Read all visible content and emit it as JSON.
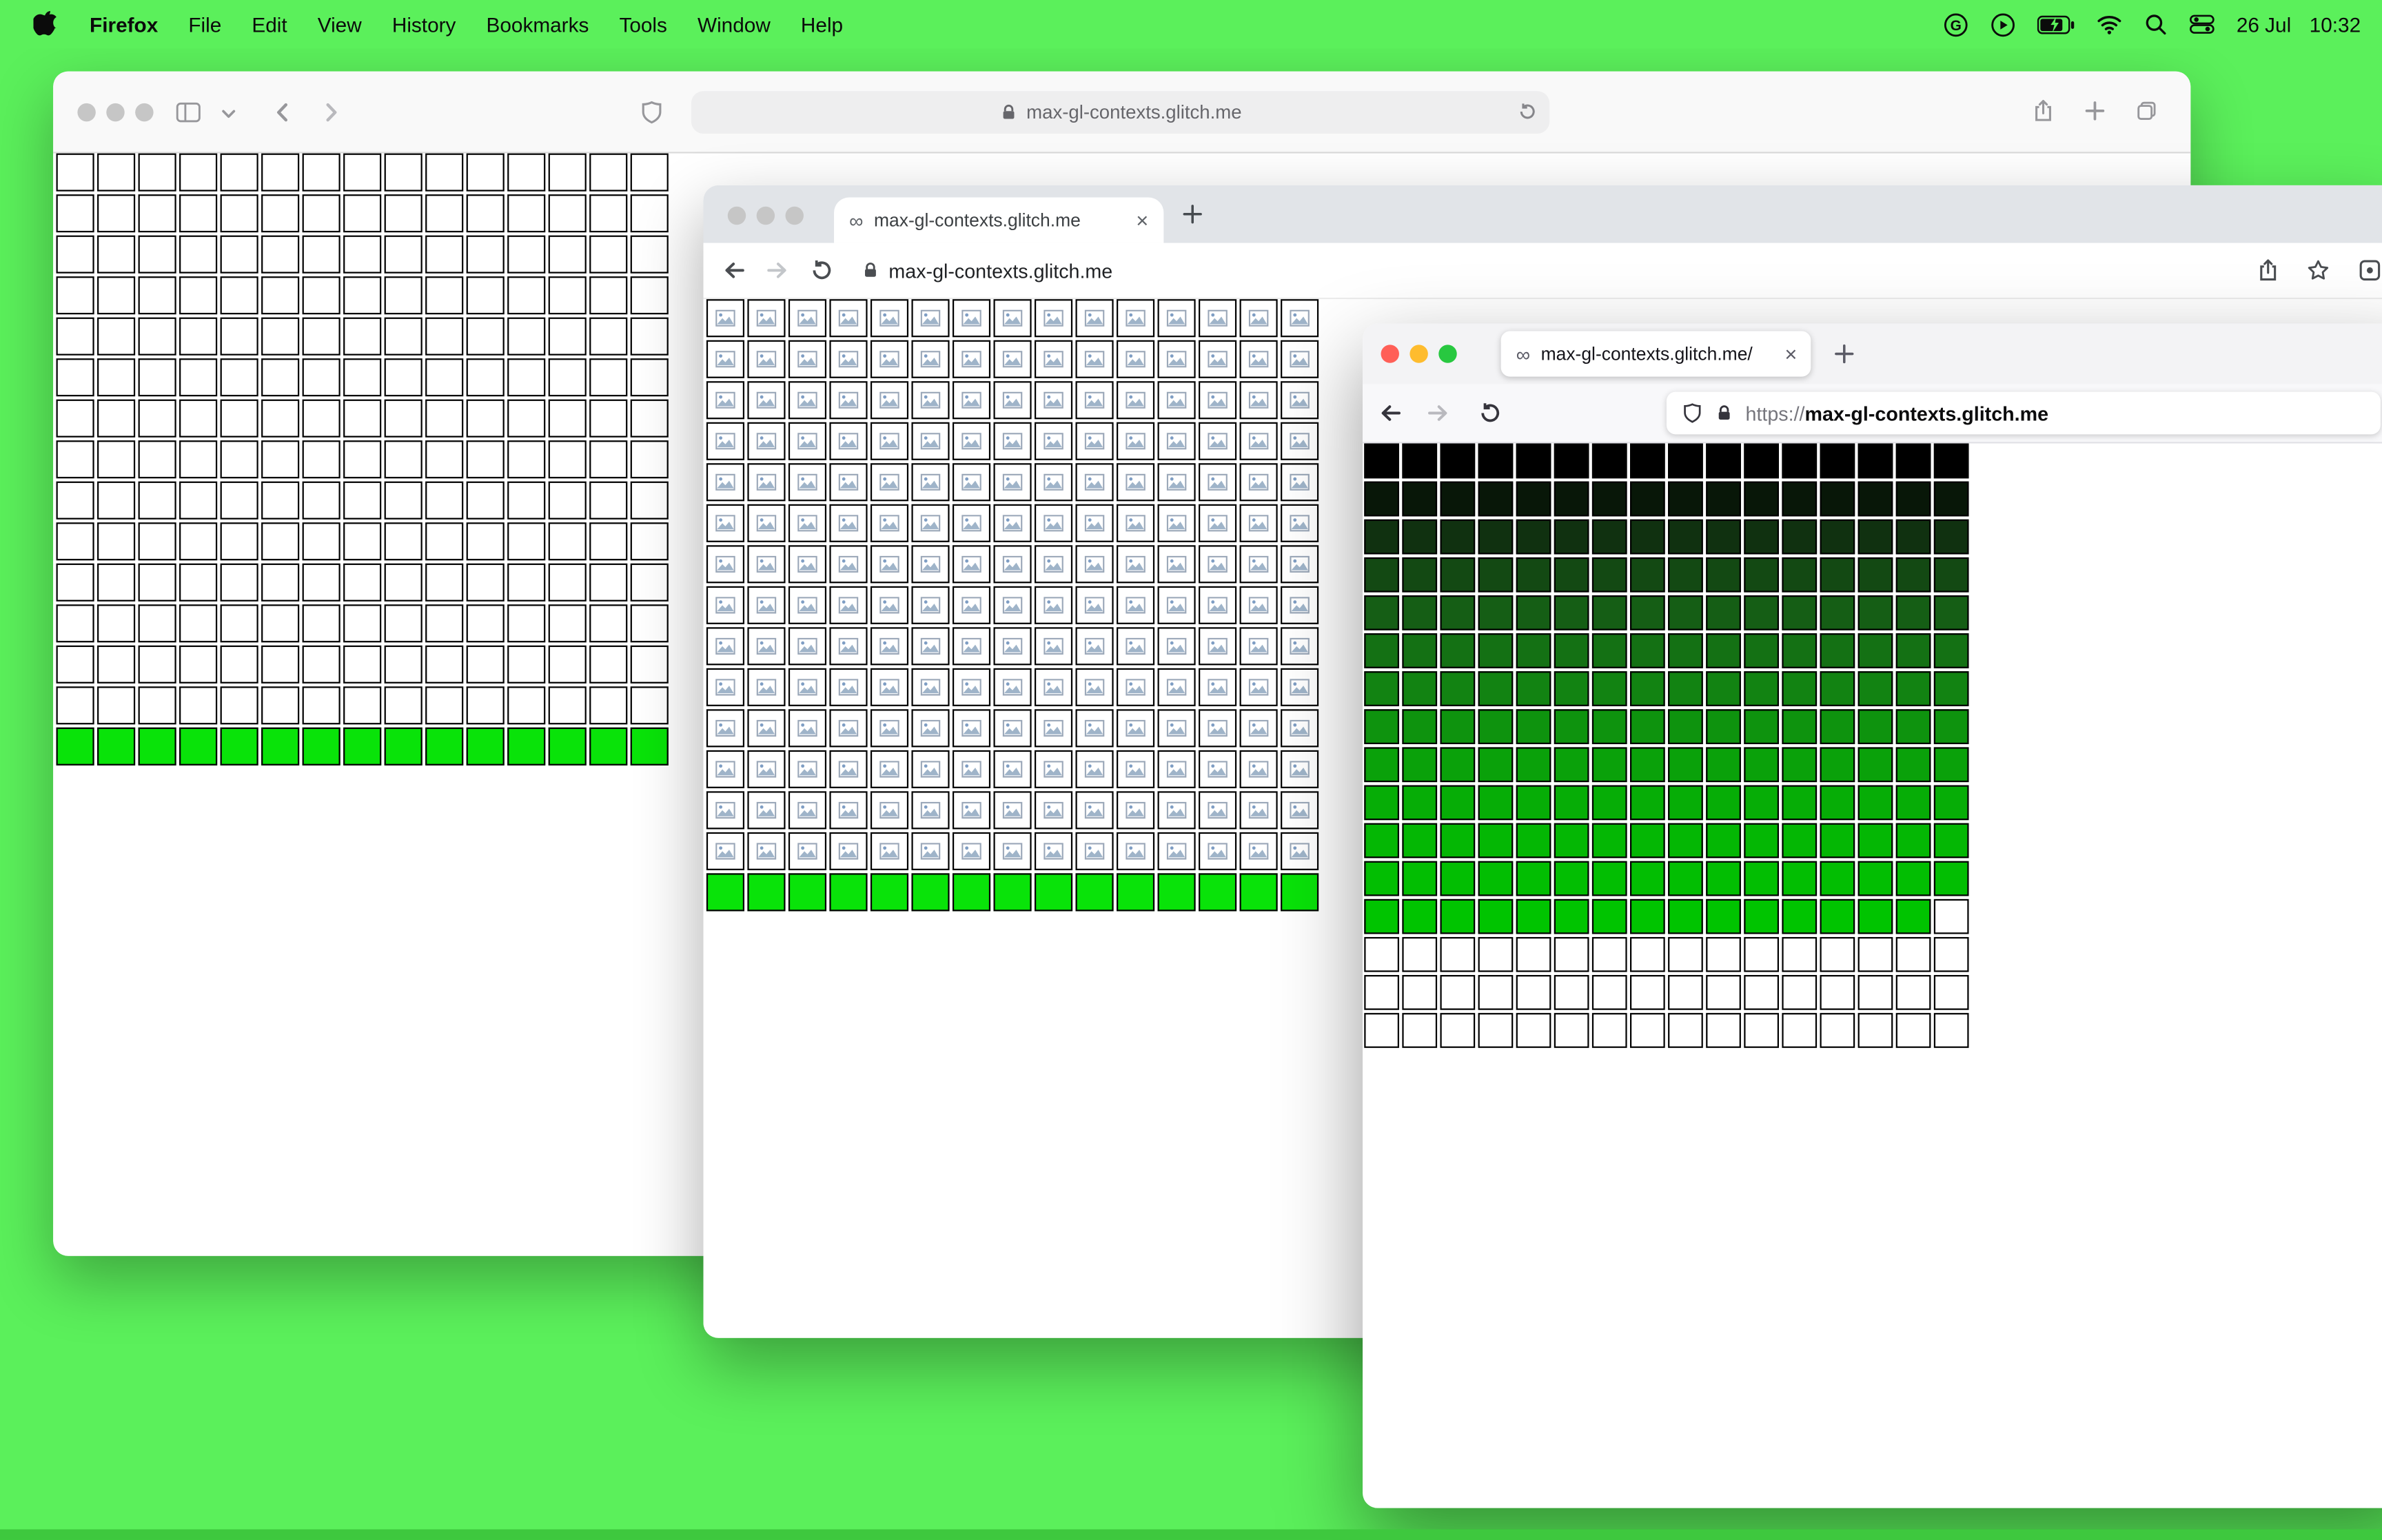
{
  "colors": {
    "desktop_green": "#5bf05b",
    "dock_strip_green": "#3ec83e",
    "bright_cell_green": "#09e309",
    "cell_border": "#000000",
    "traffic_red": "#ff5f57",
    "traffic_yellow": "#febc2e",
    "traffic_green": "#28c840"
  },
  "icons": {
    "infinity": "∞",
    "close": "×"
  },
  "menubar": {
    "app_name": "Firefox",
    "menus": [
      "File",
      "Edit",
      "View",
      "History",
      "Bookmarks",
      "Tools",
      "Window",
      "Help"
    ],
    "date": "26 Jul",
    "time": "10:32"
  },
  "safari": {
    "url": "max-gl-contexts.glitch.me"
  },
  "chrome": {
    "tab_title": "max-gl-contexts.glitch.me",
    "url": "max-gl-contexts.glitch.me"
  },
  "firefox": {
    "tab_title": "max-gl-contexts.glitch.me/",
    "url_scheme": "https://",
    "url_domain": "max-gl-contexts.glitch.me"
  },
  "grids": {
    "safari": {
      "cols": 15,
      "pitch": 27,
      "cell": 25,
      "rows": [
        {
          "count": 14,
          "color": "#ffffff"
        },
        {
          "count": 1,
          "color": "#09e309"
        }
      ]
    },
    "chrome": {
      "cols": 15,
      "pitch": 27,
      "cell": 25,
      "rows": [
        {
          "count": 14,
          "color": "#ffffff",
          "icon": "broken-image"
        },
        {
          "count": 1,
          "color": "#09e309"
        }
      ]
    },
    "firefox": {
      "cols": 16,
      "pitch": 25,
      "cell": 23,
      "rows": [
        {
          "count": 1,
          "color": "#000000"
        },
        {
          "count": 1,
          "color": "#081708"
        },
        {
          "count": 1,
          "color": "#103110"
        },
        {
          "count": 1,
          "color": "#134913"
        },
        {
          "count": 1,
          "color": "#155e15"
        },
        {
          "count": 1,
          "color": "#147114"
        },
        {
          "count": 1,
          "color": "#128312"
        },
        {
          "count": 1,
          "color": "#0e930e"
        },
        {
          "count": 1,
          "color": "#0aa10a"
        },
        {
          "count": 1,
          "color": "#06ad06"
        },
        {
          "count": 1,
          "color": "#04b704"
        },
        {
          "count": 1,
          "color": "#02be02"
        },
        {
          "count": 1,
          "color": "#00c400"
        },
        {
          "count": 3,
          "color": "#ffffff"
        }
      ],
      "overrides": [
        {
          "row": 12,
          "col": 15,
          "color": "#ffffff"
        }
      ]
    }
  }
}
